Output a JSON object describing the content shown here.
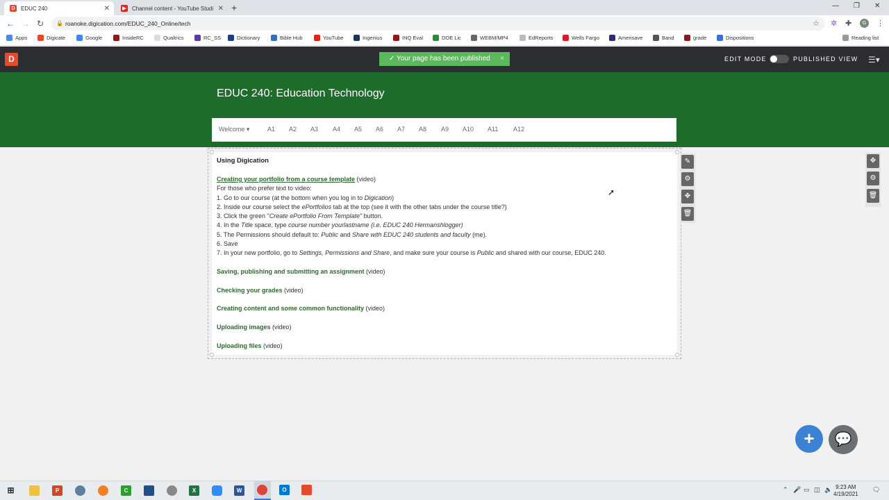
{
  "browser": {
    "tabs": [
      {
        "title": "EDUC 240",
        "active": true
      },
      {
        "title": "Channel content - YouTube Studi",
        "active": false
      }
    ],
    "url": "roanoke.digication.com/EDUC_240_Online/tech",
    "bookmarks": [
      "Apps",
      "Digicate",
      "Google",
      "InsideRC",
      "Qualtrics",
      "RC_SS",
      "Dictionary",
      "Bible Hub",
      "YouTube",
      "Ingenius",
      "INQ Eval",
      "DOE Lic",
      "WEBM/MP4",
      "EdReports",
      "Wells Fargo",
      "Amerisave",
      "Band",
      "grade",
      "Dispositions"
    ],
    "reading_list": "Reading list",
    "profile_initial": "G"
  },
  "digication": {
    "logo": "D",
    "toast": "✓ Your page has been published",
    "toast_close": "×",
    "edit_mode": "EDIT MODE",
    "published_view": "PUBLISHED VIEW",
    "edit_mode_on": false
  },
  "course": {
    "title": "EDUC 240: Education Technology",
    "nav": [
      "Welcome ▾",
      "A1",
      "A2",
      "A3",
      "A4",
      "A5",
      "A6",
      "A7",
      "A8",
      "A9",
      "A10",
      "A11",
      "A12"
    ]
  },
  "content": {
    "heading": "Using Digication",
    "link1": "Creating your portfolio from a course template",
    "video": "(video)",
    "intro": "For those who prefer text to video:",
    "steps": {
      "s1a": "1. Go to our course (at the bottom when you log in to ",
      "s1b": "Digication",
      "s1c": ")",
      "s2a": "2. Inside our course select the ",
      "s2b": "ePortfolios",
      "s2c": " tab at the top (see it with the other tabs under the course title?)",
      "s3a": "3. Click the green \"",
      "s3b": "Create ePortfolio From Template\"",
      "s3c": " button.",
      "s4a": "4. In the ",
      "s4b": "Title",
      "s4c": " space, type ",
      "s4d": "course number yourlastname (i.e. EDUC 240 Hermanshlogger)",
      "s5a": "5. The Permissions should default to: ",
      "s5b": "Public",
      "s5c": " and ",
      "s5d": "Share with EDUC 240 students and faculty",
      "s5e": " (me).",
      "s6": "6. Save",
      "s7a": "7. In your new portfolio, go to ",
      "s7b": "Settings, Permissions and Share",
      "s7c": ", and make sure your course is ",
      "s7d": "Public",
      "s7e": " and shared with our course, EDUC 240."
    },
    "links": [
      "Saving, publishing and submitting an assignment",
      "Checking your grades",
      "Creating content and some common functionality",
      "Uploading images",
      "Uploading files"
    ]
  },
  "taskbar": {
    "time": "9:23 AM",
    "date": "4/19/2021"
  }
}
